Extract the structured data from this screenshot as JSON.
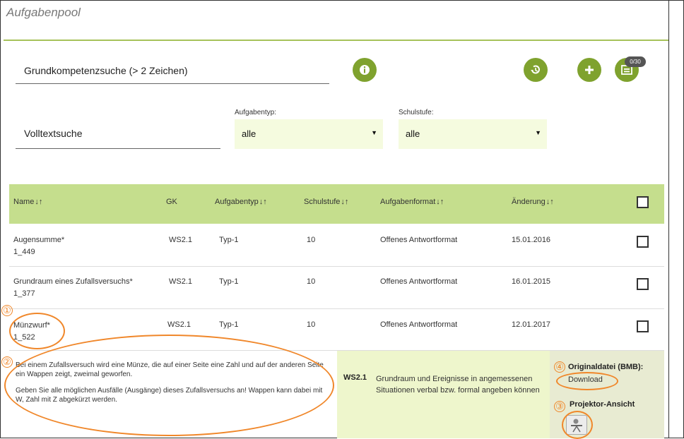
{
  "page": {
    "title": "Aufgabenpool"
  },
  "search": {
    "grundkompetenz_placeholder": "Grundkompetenzsuche (> 2 Zeichen)",
    "volltext_placeholder": "Volltextsuche",
    "cart_count": "0/30"
  },
  "filters": {
    "aufgabentyp_label": "Aufgabentyp:",
    "aufgabentyp_value": "alle",
    "schulstufe_label": "Schulstufe:",
    "schulstufe_value": "alle"
  },
  "table": {
    "headers": {
      "name": "Name",
      "gk": "GK",
      "aufgabentyp": "Aufgabentyp",
      "schulstufe": "Schulstufe",
      "aufgabenformat": "Aufgabenformat",
      "aenderung": "Änderung"
    },
    "sort_icons": "↓↑",
    "rows": [
      {
        "name": "Augensumme*",
        "id": "1_449",
        "gk": "WS2.1",
        "typ": "Typ-1",
        "stufe": "10",
        "format": "Offenes Antwortformat",
        "date": "15.01.2016"
      },
      {
        "name": "Grundraum eines Zufallsversuchs*",
        "id": "1_377",
        "gk": "WS2.1",
        "typ": "Typ-1",
        "stufe": "10",
        "format": "Offenes Antwortformat",
        "date": "16.01.2015"
      },
      {
        "name": "Münzwurf*",
        "id": "1_522",
        "gk": "WS2.1",
        "typ": "Typ-1",
        "stufe": "10",
        "format": "Offenes Antwortformat",
        "date": "12.01.2017"
      }
    ]
  },
  "detail": {
    "desc1": "Bei einem Zufallsversuch wird eine Münze, die auf einer Seite eine Zahl und auf der anderen Seite ein Wappen zeigt, zweimal geworfen.",
    "desc2": "Geben Sie alle möglichen Ausfälle (Ausgänge) dieses Zufallsversuchs an! Wappen kann dabei mit W, Zahl mit Z abgekürzt werden.",
    "gk_code": "WS2.1",
    "gk_text": "Grundraum und Ereignisse in angemessenen Situationen verbal bzw. formal angeben können",
    "original_label": "Originaldatei (BMB):",
    "download_label": "Download",
    "projector_label": "Projektor-Ansicht"
  },
  "annotations": [
    "①",
    "②",
    "③",
    "④"
  ],
  "colors": {
    "accent": "#7fa22e",
    "header_bg": "#c5de8d",
    "annotation": "#f0872a"
  }
}
